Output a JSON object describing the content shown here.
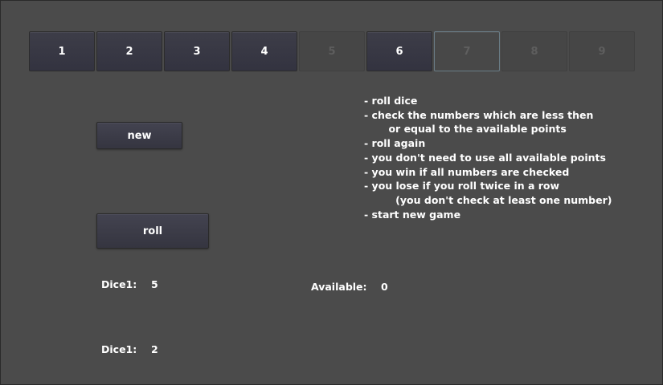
{
  "numbers": [
    {
      "label": "1",
      "state": "enabled"
    },
    {
      "label": "2",
      "state": "enabled"
    },
    {
      "label": "3",
      "state": "enabled"
    },
    {
      "label": "4",
      "state": "enabled"
    },
    {
      "label": "5",
      "state": "disabled"
    },
    {
      "label": "6",
      "state": "enabled"
    },
    {
      "label": "7",
      "state": "focused-disabled"
    },
    {
      "label": "8",
      "state": "disabled"
    },
    {
      "label": "9",
      "state": "disabled"
    }
  ],
  "buttons": {
    "new_label": "new",
    "roll_label": "roll"
  },
  "instructions": [
    "- roll dice",
    "- check the numbers which are less then",
    "       or equal to the available points",
    "- roll again",
    "",
    "- you don't need to use all available points",
    "- you win if all numbers are checked",
    "- you lose if you roll twice in a row",
    "         (you don't check at least one number)",
    "- start new game"
  ],
  "dice": [
    {
      "label": "Dice1:",
      "value": "5"
    },
    {
      "label": "Dice1:",
      "value": "2"
    }
  ],
  "available": {
    "label": "Available:",
    "value": "0"
  },
  "colors": {
    "background": "#4b4b4b",
    "button": "#3a3a46",
    "disabled_text": "#5e5e5e",
    "focus_border": "#6a7c86"
  }
}
